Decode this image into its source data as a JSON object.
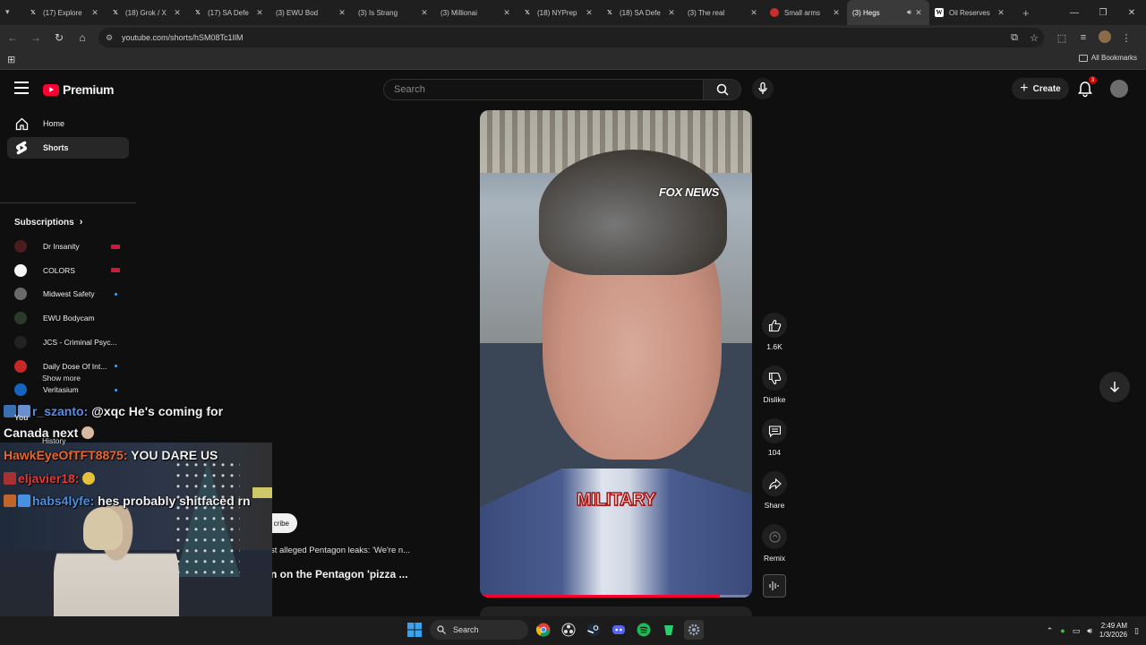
{
  "browser": {
    "tabs": [
      {
        "label": "(17) Explore",
        "favicon": "x"
      },
      {
        "label": "(18) Grok / X",
        "favicon": "x"
      },
      {
        "label": "(17) SA Defe",
        "favicon": "x"
      },
      {
        "label": "(3) EWU Bod",
        "favicon": "yt"
      },
      {
        "label": "(3) Is Strang",
        "favicon": "yt"
      },
      {
        "label": "(3) Millionai",
        "favicon": "yt"
      },
      {
        "label": "(18) NYPrep",
        "favicon": "x"
      },
      {
        "label": "(18) SA Defe",
        "favicon": "x"
      },
      {
        "label": "(3) The real",
        "favicon": "yt"
      },
      {
        "label": "Small arms",
        "favicon": "red"
      },
      {
        "label": "(3) Hegs",
        "favicon": "yt",
        "active": true
      },
      {
        "label": "Oil Reserves",
        "favicon": "w"
      }
    ],
    "url": "youtube.com/shorts/hSM08Tc1IlM",
    "bookmarks_label": "All Bookmarks"
  },
  "youtube": {
    "logo_text": "Premium",
    "search_placeholder": "Search",
    "create_label": "Create",
    "notification_count": "3",
    "nav": [
      {
        "label": "Home",
        "icon": "home-icon"
      },
      {
        "label": "Shorts",
        "icon": "shorts-icon",
        "selected": true
      }
    ],
    "subscriptions_heading": "Subscriptions",
    "subscriptions": [
      {
        "label": "Dr Insanity",
        "color": "#4a1c1c",
        "status": "live"
      },
      {
        "label": "COLORS",
        "color": "#f5f5f5",
        "status": "live"
      },
      {
        "label": "Midwest Safety",
        "color": "#6a6a6a",
        "status": "new"
      },
      {
        "label": "EWU Bodycam",
        "color": "#2b3a2b",
        "status": ""
      },
      {
        "label": "JCS - Criminal Psyc...",
        "color": "#222222",
        "status": ""
      },
      {
        "label": "Daily Dose Of Int...",
        "color": "#c62828",
        "status": "new"
      },
      {
        "label": "Veritasium",
        "color": "#1565c0",
        "status": "new"
      }
    ],
    "show_more": "Show more",
    "you_label": "You",
    "history_label": "History",
    "subscribe_label": "cribe",
    "video_title_1": "st alleged Pentagon leaks: 'We're n...",
    "video_title_2": "n on the Pentagon 'pizza ...",
    "short": {
      "watermark": "FOX NEWS",
      "caption": "MILITARY",
      "progress": 0.88
    },
    "actions": {
      "likes": "1.6K",
      "dislike": "Dislike",
      "comments": "104",
      "share": "Share",
      "remix": "Remix"
    }
  },
  "chat": [
    {
      "user": "r_szanto",
      "color": "#5b8ce8",
      "message": "@xqc He's coming for",
      "continuation": "Canada next"
    },
    {
      "user": "HawkEyeOfTFT8875",
      "color": "#e8692e",
      "message": "YOU DARE US"
    },
    {
      "user": "eljavier18",
      "color": "#e23a3a",
      "message": ""
    },
    {
      "user": "habs4lyfe",
      "color": "#4a90e2",
      "message": "hes probably shitfaced rn"
    }
  ],
  "taskbar": {
    "search_label": "Search",
    "time": "2:49 AM",
    "date": "1/3/2026"
  },
  "colors": {
    "accent_red": "#ff0033",
    "bg": "#0f0f0f"
  }
}
